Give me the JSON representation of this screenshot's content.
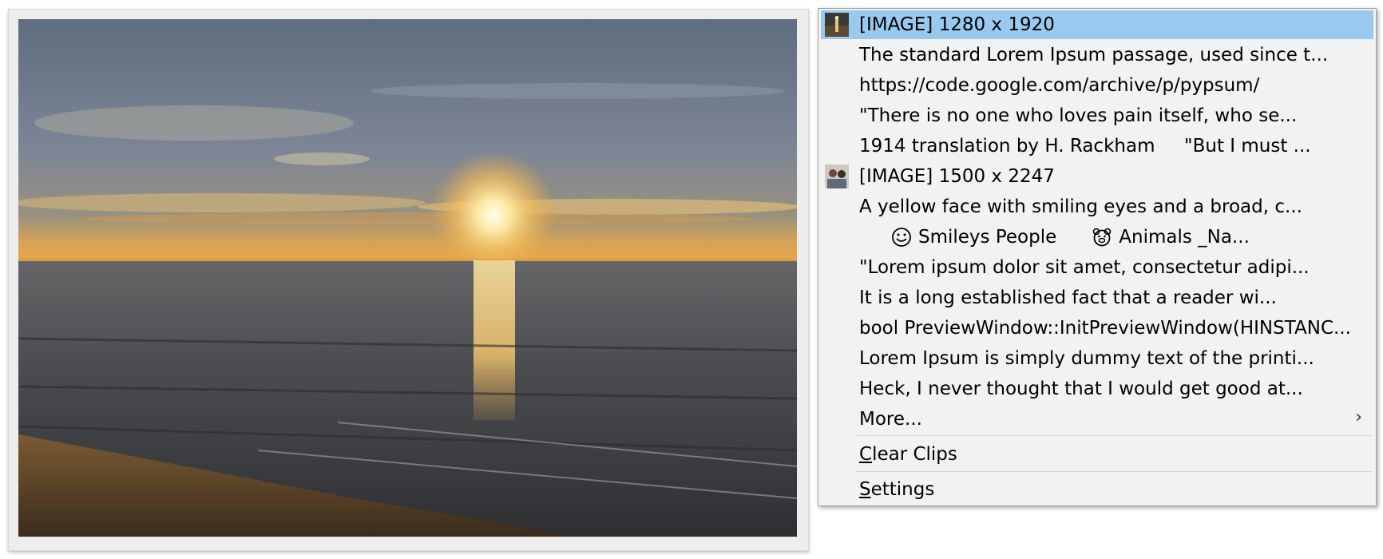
{
  "preview": {
    "image_name": "sunrise-over-ocean-image"
  },
  "menu": {
    "items": [
      {
        "kind": "image",
        "label": "[IMAGE] 1280 x 1920",
        "thumb": "lighthouse-thumbnail"
      },
      {
        "kind": "text",
        "label": "The standard Lorem Ipsum passage, used since t..."
      },
      {
        "kind": "text",
        "label": "https://code.google.com/archive/p/pypsum/"
      },
      {
        "kind": "text",
        "label": "\"There is no one who loves pain itself, who se..."
      },
      {
        "kind": "text",
        "label": "1914 translation by H. Rackham     \"But I must ..."
      },
      {
        "kind": "image",
        "label": "[IMAGE] 1500 x 2247",
        "thumb": "people-photo-thumbnail"
      },
      {
        "kind": "text",
        "label": "A yellow face with smiling eyes and a broad, c..."
      },
      {
        "kind": "emoji",
        "part1": "Smileys  People",
        "part2": "Animals _Na...",
        "icon1": "smiley-face-icon",
        "icon2": "bear-face-icon"
      },
      {
        "kind": "text",
        "label": "\"Lorem ipsum dolor sit amet, consectetur adipi..."
      },
      {
        "kind": "text",
        "label": "It is a long established fact that a reader wi..."
      },
      {
        "kind": "text",
        "label": "bool PreviewWindow::InitPreviewWindow(HINSTANC..."
      },
      {
        "kind": "text",
        "label": "Lorem Ipsum is simply dummy text of the printi..."
      },
      {
        "kind": "text",
        "label": "Heck, I never thought that I would get good at..."
      }
    ],
    "more_label": "More...",
    "clear_first": "C",
    "clear_rest": "lear Clips",
    "settings_first": "S",
    "settings_rest": "ettings",
    "submenu_icon": "chevron-right-icon",
    "selected_color": "#99c9ef"
  }
}
